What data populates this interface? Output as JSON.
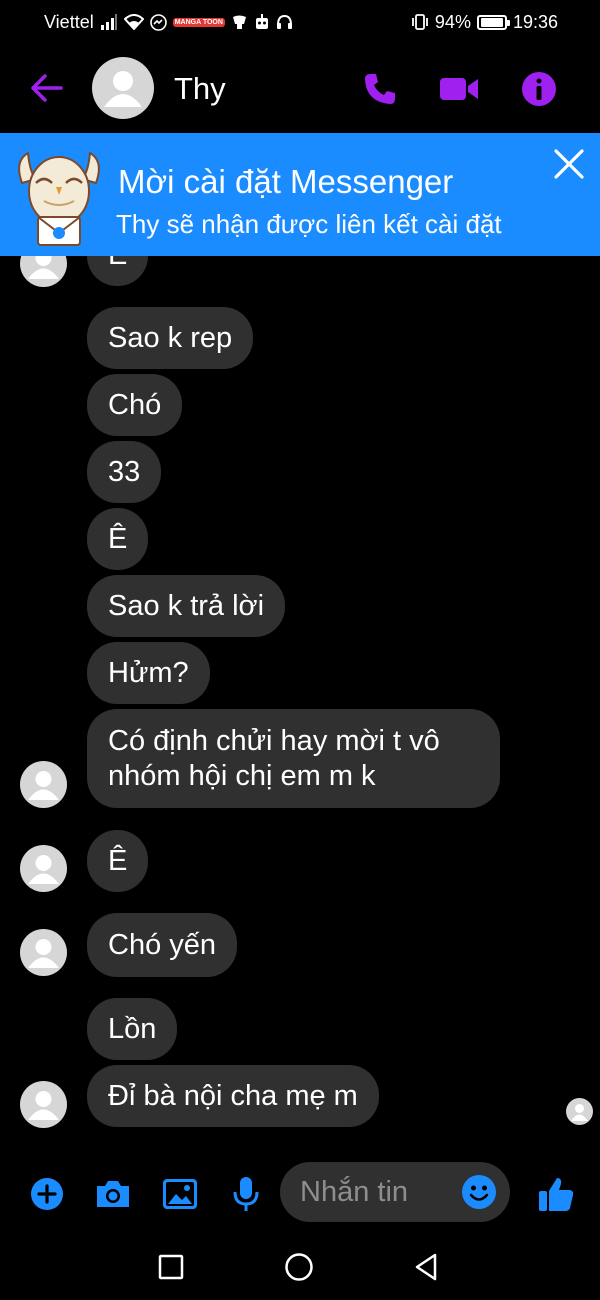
{
  "status_bar": {
    "carrier": "Viettel",
    "battery_percent": "94%",
    "battery_level": 0.94,
    "time": "19:36",
    "manga_badge": "MANGA TOON"
  },
  "header": {
    "contact_name": "Thy",
    "icons": [
      "back-arrow-icon",
      "phone-icon",
      "video-camera-icon",
      "info-icon"
    ],
    "accent_color": "#a020f0"
  },
  "banner": {
    "title": "Mời cài đặt Messenger",
    "subtitle": "Thy sẽ nhận được liên kết cài đặt",
    "background_color": "#1a8cff"
  },
  "messages": [
    {
      "text": "Ê",
      "avatar": true
    },
    {
      "text": "Sao k rep",
      "avatar": false
    },
    {
      "text": "Chó",
      "avatar": false
    },
    {
      "text": "33",
      "avatar": false
    },
    {
      "text": "Ê",
      "avatar": false
    },
    {
      "text": "Sao k trả lời",
      "avatar": false
    },
    {
      "text": "Hửm?",
      "avatar": false
    },
    {
      "text": "Có định chửi hay mời t vô nhóm hội chị em m k",
      "line1": "Có định chửi hay mời t vô",
      "line2": "nhóm hội chị em m k",
      "avatar": true
    },
    {
      "text": "Ê",
      "avatar": true
    },
    {
      "text": "Chó yến",
      "avatar": true
    },
    {
      "text": "Lồn",
      "avatar": false
    },
    {
      "text": "Đỉ bà nội cha mẹ m",
      "avatar": true
    }
  ],
  "composer": {
    "placeholder": "Nhắn tin",
    "icons": [
      "plus-icon",
      "camera-icon",
      "image-icon",
      "microphone-icon",
      "emoji-icon",
      "thumbs-up-icon"
    ],
    "accent_color": "#1a8cff"
  },
  "navbar": {
    "icons": [
      "recent-apps-icon",
      "home-icon",
      "back-icon"
    ]
  }
}
